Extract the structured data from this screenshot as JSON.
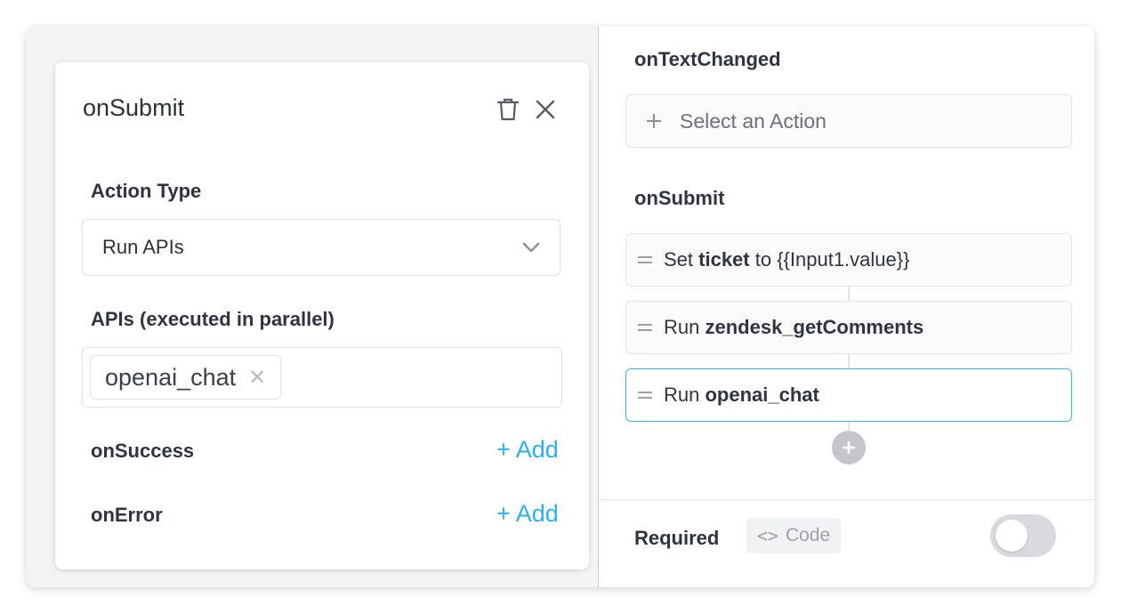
{
  "left_card": {
    "title": "onSubmit",
    "action_type_label": "Action Type",
    "action_type_value": "Run APIs",
    "apis_label": "APIs (executed in parallel)",
    "api_chips": [
      "openai_chat"
    ],
    "on_success_label": "onSuccess",
    "on_error_label": "onError",
    "add_label": "+ Add"
  },
  "right_panel": {
    "on_text_changed_title": "onTextChanged",
    "select_action_placeholder": "Select an Action",
    "on_submit_title": "onSubmit",
    "actions": [
      {
        "prefix": "Set ",
        "bold": "ticket",
        "suffix": " to {{Input1.value}}"
      },
      {
        "prefix": "Run ",
        "bold": "zendesk_getComments",
        "suffix": ""
      },
      {
        "prefix": "Run ",
        "bold": "openai_chat",
        "suffix": ""
      }
    ],
    "required_label": "Required",
    "code_label": "Code",
    "required_toggle_on": false
  },
  "colors": {
    "accent": "#2eaeea",
    "selected_border": "#3db4ea"
  }
}
